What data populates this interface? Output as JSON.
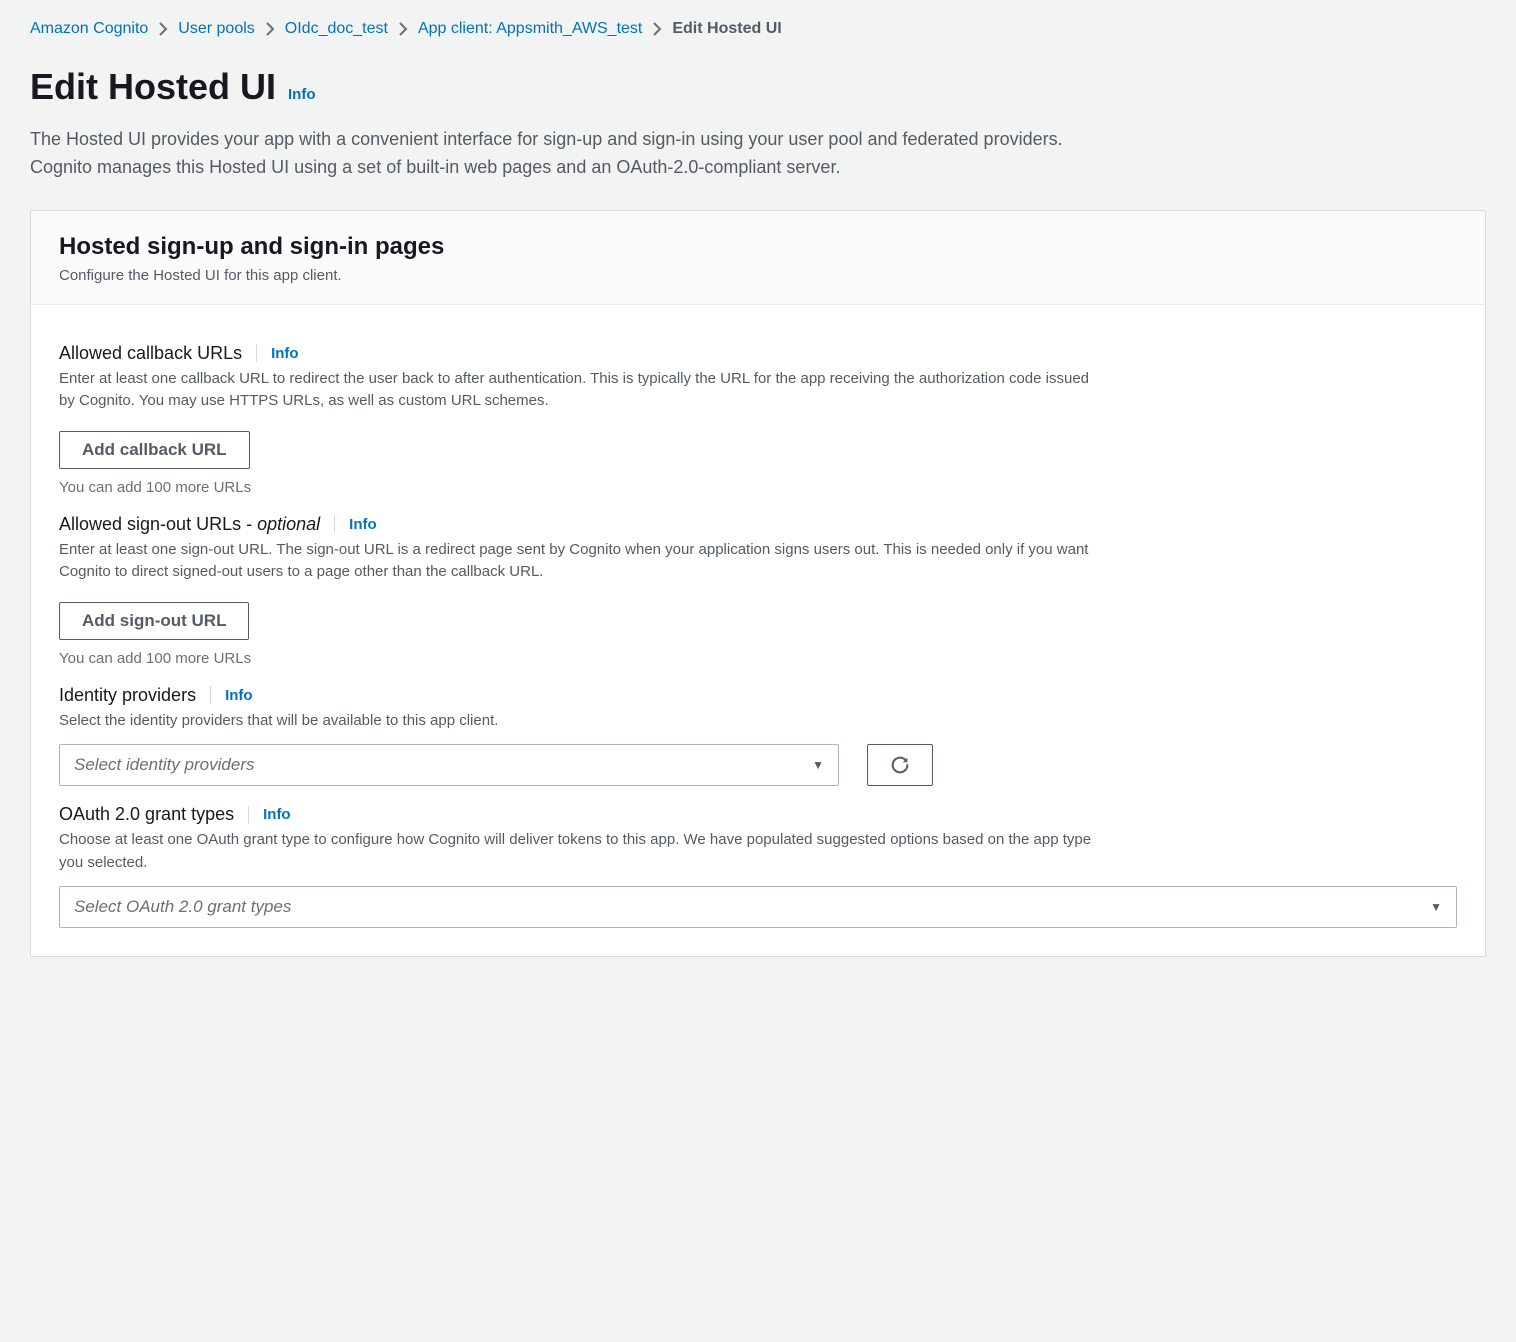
{
  "breadcrumb": {
    "items": [
      {
        "label": "Amazon Cognito"
      },
      {
        "label": "User pools"
      },
      {
        "label": "OIdc_doc_test"
      },
      {
        "label": "App client: Appsmith_AWS_test"
      }
    ],
    "current": "Edit Hosted UI"
  },
  "page": {
    "title": "Edit Hosted UI",
    "info": "Info",
    "description": "The Hosted UI provides your app with a convenient interface for sign-up and sign-in using your user pool and federated providers. Cognito manages this Hosted UI using a set of built-in web pages and an OAuth-2.0-compliant server."
  },
  "panel": {
    "title": "Hosted sign-up and sign-in pages",
    "subtitle": "Configure the Hosted UI for this app client."
  },
  "callback": {
    "label": "Allowed callback URLs",
    "info": "Info",
    "description": "Enter at least one callback URL to redirect the user back to after authentication. This is typically the URL for the app receiving the authorization code issued by Cognito. You may use HTTPS URLs, as well as custom URL schemes.",
    "button": "Add callback URL",
    "hint": "You can add 100 more URLs"
  },
  "signout": {
    "label": "Allowed sign-out URLs - ",
    "optional": "optional",
    "info": "Info",
    "description": "Enter at least one sign-out URL. The sign-out URL is a redirect page sent by Cognito when your application signs users out. This is needed only if you want Cognito to direct signed-out users to a page other than the callback URL.",
    "button": "Add sign-out URL",
    "hint": "You can add 100 more URLs"
  },
  "idp": {
    "label": "Identity providers",
    "info": "Info",
    "description": "Select the identity providers that will be available to this app client.",
    "placeholder": "Select identity providers"
  },
  "grant": {
    "label": "OAuth 2.0 grant types",
    "info": "Info",
    "description": "Choose at least one OAuth grant type to configure how Cognito will deliver tokens to this app. We have populated suggested options based on the app type you selected.",
    "placeholder": "Select OAuth 2.0 grant types"
  }
}
